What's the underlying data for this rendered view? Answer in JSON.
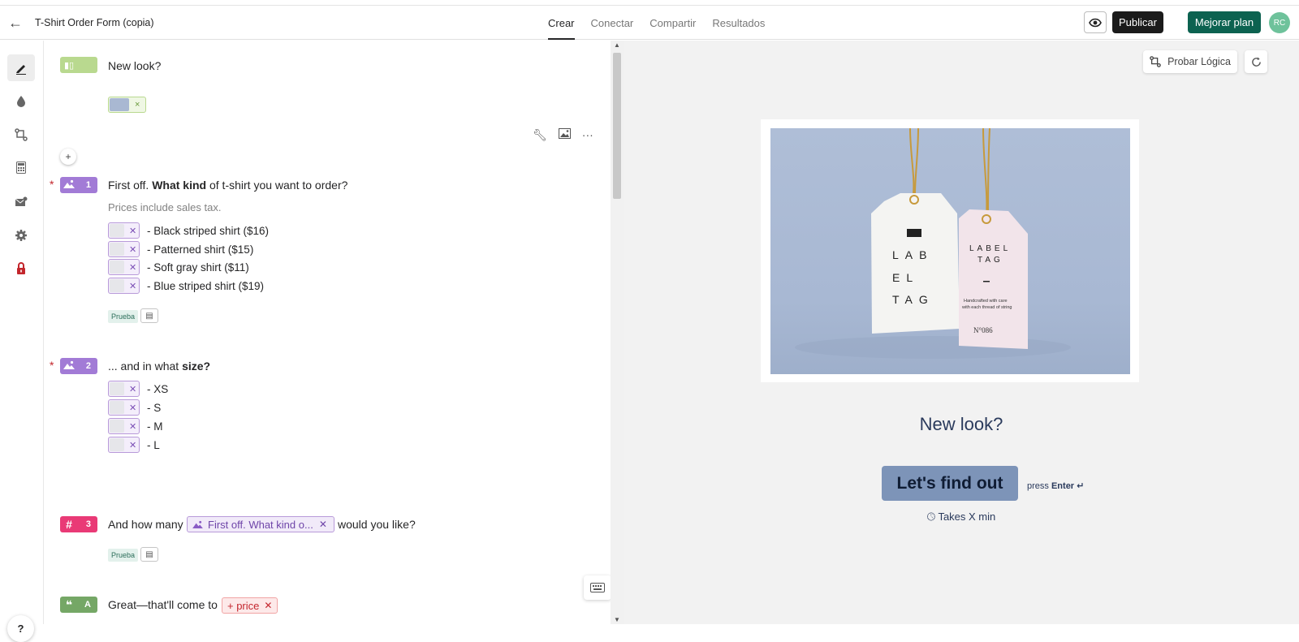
{
  "header": {
    "form_title": "T-Shirt Order Form (copia)",
    "tabs": [
      {
        "label": "Crear",
        "active": true
      },
      {
        "label": "Conectar",
        "active": false
      },
      {
        "label": "Compartir",
        "active": false
      },
      {
        "label": "Resultados",
        "active": false
      }
    ],
    "publish_label": "Publicar",
    "upgrade_label": "Mejorar plan",
    "avatar_initials": "RC"
  },
  "sidebar": {
    "items": [
      "pencil-icon",
      "drop-icon",
      "logic-icon",
      "calculator-icon",
      "mail-icon",
      "gear-icon",
      "lock-icon"
    ],
    "help_label": "?"
  },
  "editor": {
    "welcome": {
      "title": "New look?"
    },
    "q1": {
      "number": "1",
      "title_pre": "First off. ",
      "title_bold": "What kind",
      "title_post": " of t-shirt you want to order?",
      "subtitle": "Prices include sales tax.",
      "choices": [
        "- Black striped shirt ($16)",
        "- Patterned shirt ($15)",
        "- Soft gray shirt ($11)",
        "- Blue striped shirt  ($19)"
      ],
      "tag": "Prueba"
    },
    "q2": {
      "number": "2",
      "title_pre": "... and in what ",
      "title_bold": "size?",
      "choices": [
        "- XS",
        "- S",
        "- M",
        "- L"
      ]
    },
    "q3": {
      "number": "3",
      "title_pre": "And how many",
      "ref_label": "First off. What kind o...",
      "title_post": "would you like?",
      "tag": "Prueba"
    },
    "statement": {
      "letter": "A",
      "text": "Great—that'll come to",
      "var_label": "+ price"
    }
  },
  "preview": {
    "test_logic_label": "Probar Lógica",
    "title": "New look?",
    "cta_label": "Let's find out",
    "press_label": "press",
    "press_key": "Enter ↵",
    "time_label": "Takes X min"
  },
  "colors": {
    "accent_green": "#0c6250",
    "picture_choice": "#a27bd6",
    "number": "#e93a76",
    "welcome": "#b9d98f",
    "statement": "#75a766"
  }
}
